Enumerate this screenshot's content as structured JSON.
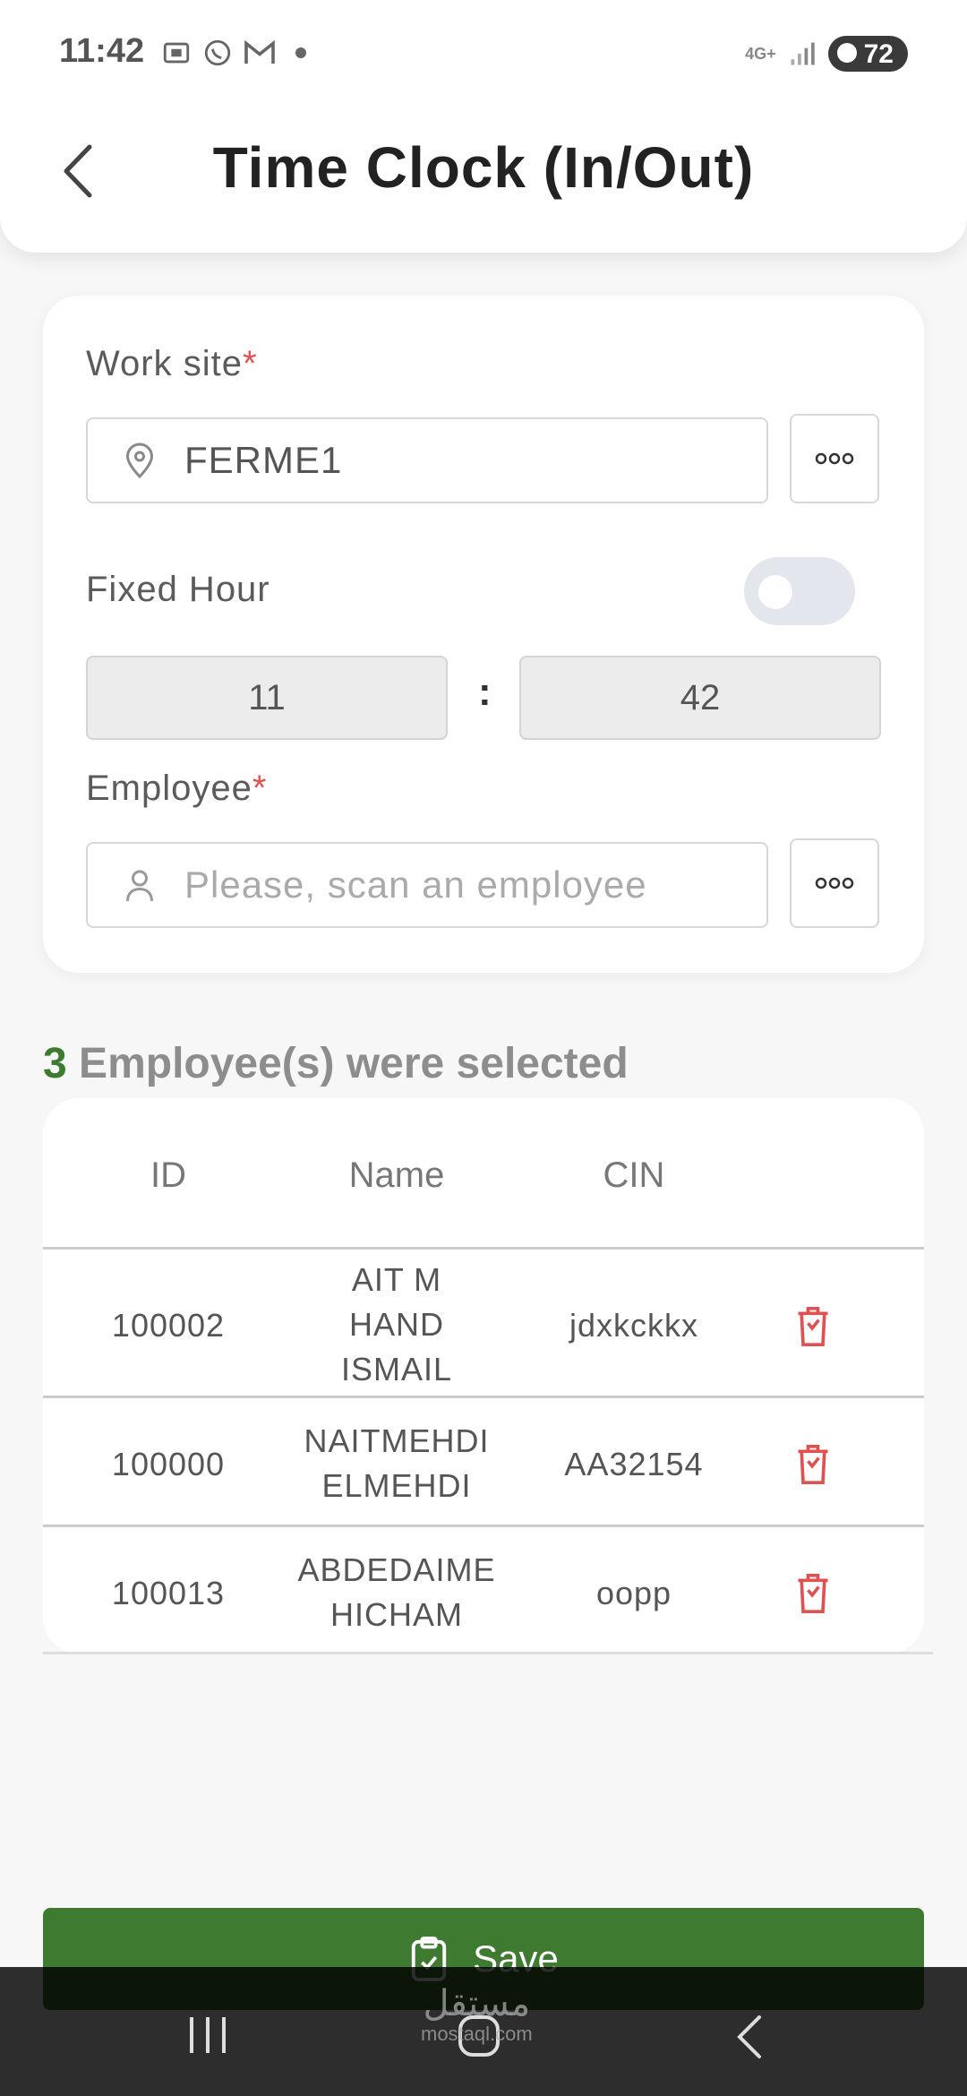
{
  "status_bar": {
    "time": "11:42",
    "network": "4G+",
    "battery": "72"
  },
  "header": {
    "title": "Time Clock (In/Out)"
  },
  "form": {
    "work_site_label": "Work site",
    "work_site_value": "FERME1",
    "required_mark": "*",
    "fixed_hour_label": "Fixed Hour",
    "fixed_hour_enabled": false,
    "hour": "11",
    "minute": "42",
    "time_separator": ":",
    "employee_label": "Employee",
    "employee_placeholder": "Please, scan an employee"
  },
  "selection": {
    "count": "3",
    "text": "Employee(s) were selected"
  },
  "table": {
    "headers": [
      "ID",
      "Name",
      "CIN",
      ""
    ],
    "rows": [
      {
        "id": "100002",
        "name_lines": [
          "AIT M",
          "HAND",
          "ISMAIL"
        ],
        "cin": "jdxkckkx"
      },
      {
        "id": "100000",
        "name_lines": [
          "NAITMEHDI",
          "ELMEHDI"
        ],
        "cin": "AA32154"
      },
      {
        "id": "100013",
        "name_lines": [
          "ABDEDAIME",
          "HICHAM"
        ],
        "cin": "oopp"
      }
    ]
  },
  "actions": {
    "save_label": "Save"
  },
  "watermark": {
    "line1": "مستقل",
    "line2": "mostaql.com"
  },
  "colors": {
    "accent": "#3e7a2f",
    "danger": "#e05252"
  }
}
